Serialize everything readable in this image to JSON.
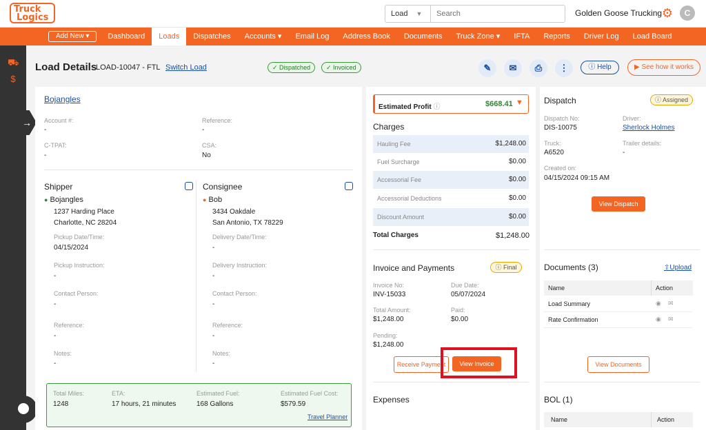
{
  "header": {
    "logo_line1": "Truck",
    "logo_line2": "Logics",
    "search": {
      "type_value": "Load",
      "placeholder": "Search"
    },
    "company": "Golden Goose Trucking",
    "avatar_initial": "C"
  },
  "nav": {
    "add_new": "Add New",
    "items": [
      "Dashboard",
      "Loads",
      "Dispatches",
      "Accounts",
      "Email Log",
      "Address Book",
      "Documents",
      "Truck Zone",
      "IFTA",
      "Reports",
      "Driver Log",
      "Load Board"
    ],
    "active": "Loads"
  },
  "page": {
    "title": "Load Details",
    "load_id": "LOAD-10047 - FTL",
    "switch_load": "Switch Load",
    "status_dispatched": "Dispatched",
    "status_invoiced": "Invoiced",
    "help": "Help",
    "how_it_works": "See how it works"
  },
  "customer": {
    "name": "Bojangles",
    "account_label": "Account #:",
    "account_value": "-",
    "reference_label": "Reference:",
    "reference_value": "-",
    "ctpat_label": "C-TPAT:",
    "ctpat_value": "-",
    "csa_label": "CSA:",
    "csa_value": "No"
  },
  "shipper": {
    "heading": "Shipper",
    "name": "Bojangles",
    "address1": "1237 Harding Place",
    "address2": "Charlotte, NC 28204",
    "date_label": "Pickup Date/Time:",
    "date_value": "04/15/2024",
    "instruction_label": "Pickup Instruction:",
    "instruction_value": "-",
    "contact_label": "Contact Person:",
    "contact_value": "-",
    "reference_label": "Reference:",
    "reference_value": "-",
    "notes_label": "Notes:",
    "notes_value": "-"
  },
  "consignee": {
    "heading": "Consignee",
    "name": "Bob",
    "address1": "3434 Oakdale",
    "address2": "San Antonio, TX 78229",
    "date_label": "Delivery Date/Time:",
    "date_value": "-",
    "instruction_label": "Delivery Instruction:",
    "instruction_value": "-",
    "contact_label": "Contact Person:",
    "contact_value": "-",
    "reference_label": "Reference:",
    "reference_value": "-",
    "notes_label": "Notes:",
    "notes_value": "-"
  },
  "trip": {
    "miles_label": "Total Miles:",
    "miles_value": "1248",
    "eta_label": "ETA:",
    "eta_value": "17 hours, 21 minutes",
    "fuel_label": "Estimated Fuel:",
    "fuel_value": "168 Gallons",
    "fuel_cost_label": "Estimated Fuel Cost:",
    "fuel_cost_value": "$579.59",
    "planner": "Travel Planner"
  },
  "profit": {
    "label": "Estimated Profit",
    "value": "$668.41"
  },
  "charges": {
    "heading": "Charges",
    "rows": [
      {
        "label": "Hauling Fee",
        "value": "$1,248.00"
      },
      {
        "label": "Fuel Surcharge",
        "value": "$0.00"
      },
      {
        "label": "Accessorial Fee",
        "value": "$0.00"
      },
      {
        "label": "Accessorial Deductions",
        "value": "$0.00"
      },
      {
        "label": "Discount Amount",
        "value": "$0.00"
      }
    ],
    "total_label": "Total Charges",
    "total_value": "$1,248.00"
  },
  "invoice": {
    "heading": "Invoice and Payments",
    "status": "Final",
    "no_label": "Invoice No:",
    "no_value": "INV-15033",
    "due_label": "Due Date:",
    "due_value": "05/07/2024",
    "total_label": "Total Amount:",
    "total_value": "$1,248.00",
    "paid_label": "Paid:",
    "paid_value": "$0.00",
    "pending_label": "Pending:",
    "pending_value": "$1,248.00",
    "receive_payment": "Receive Payment",
    "view_invoice": "View Invoice"
  },
  "expenses": {
    "heading": "Expenses"
  },
  "dispatch": {
    "heading": "Dispatch",
    "status": "Assigned",
    "no_label": "Dispatch No:",
    "no_value": "DIS-10075",
    "driver_label": "Driver:",
    "driver_value": "Sherlock Holmes",
    "truck_label": "Truck:",
    "truck_value": "A6520",
    "trailer_label": "Trailer details:",
    "trailer_value": "-",
    "created_label": "Created on:",
    "created_value": "04/15/2024 09:15 AM",
    "view_dispatch": "View Dispatch"
  },
  "documents": {
    "heading": "Documents (3)",
    "upload": "Upload",
    "col_name": "Name",
    "col_action": "Action",
    "rows": [
      "Load Summary",
      "Rate Confirmation"
    ],
    "view_documents": "View Documents"
  },
  "bol": {
    "heading": "BOL (1)",
    "col_name": "Name",
    "col_action": "Action"
  },
  "colors": {
    "brand": "#f26522",
    "link": "#1a4fa3",
    "success": "#3a9a3a",
    "highlight": "#e0101e"
  }
}
